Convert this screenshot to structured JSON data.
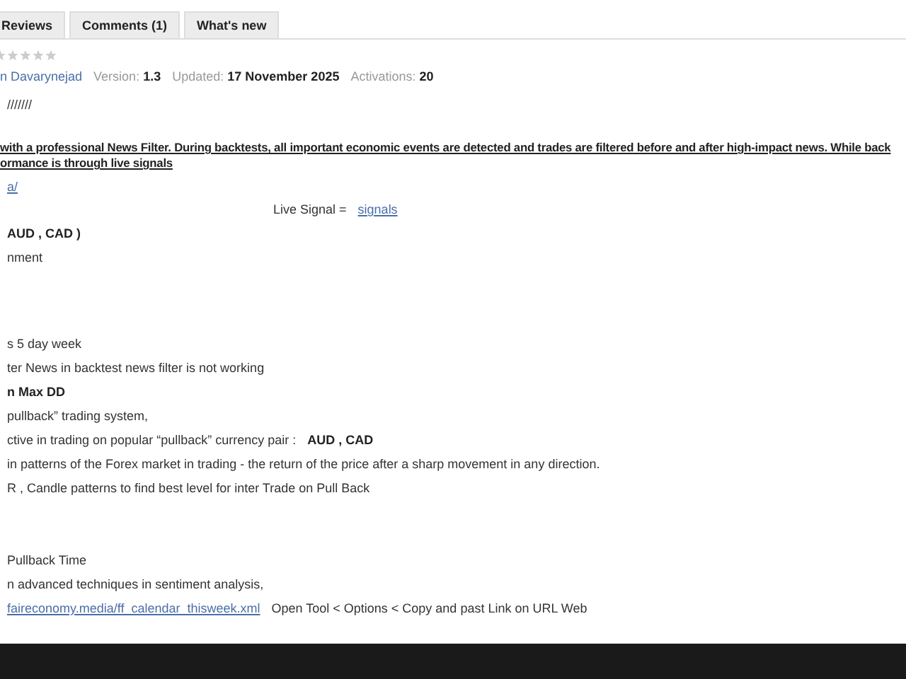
{
  "tabs": [
    {
      "label": "Reviews",
      "selected": false
    },
    {
      "label": "Comments (1)",
      "selected": false
    },
    {
      "label": "What's new",
      "selected": false
    }
  ],
  "rating": {
    "stars": 0
  },
  "meta": {
    "author": "n Davarynejad",
    "fields": [
      {
        "label": "Version:",
        "value": "1.3"
      },
      {
        "label": "Updated:",
        "value": "17 November 2025"
      },
      {
        "label": "Activations:",
        "value": "20"
      }
    ]
  },
  "lines": [
    {
      "kind": "plain",
      "parts": [
        {
          "kind": "plain",
          "text": "///////"
        }
      ]
    },
    {
      "kind": "headline",
      "parts": [
        {
          "kind": "bold-link",
          "text": "with a professional News Filter. During backtests, all important economic events are detected and trades are filtered before and after high-impact news. While back"
        }
      ]
    },
    {
      "kind": "headline",
      "parts": [
        {
          "kind": "bold-link",
          "text": "ormance is through live signals"
        }
      ]
    },
    {
      "kind": "plain",
      "parts": [
        {
          "kind": "link",
          "text": "a/"
        }
      ]
    },
    {
      "kind": "centered",
      "parts": [
        {
          "kind": "plain",
          "text": "Live Signal  ="
        },
        {
          "kind": "link",
          "text": "signals"
        }
      ]
    },
    {
      "kind": "plain",
      "parts": [
        {
          "kind": "bold",
          "text": "AUD , CAD )"
        }
      ]
    },
    {
      "kind": "plain",
      "parts": [
        {
          "kind": "plain",
          "text": "nment"
        }
      ]
    },
    {
      "kind": "plain",
      "parts": [
        {
          "kind": "plain",
          "text": "s   5 day week"
        }
      ]
    },
    {
      "kind": "plain",
      "parts": [
        {
          "kind": "plain",
          "text": "ter News  in  backtest news filter is not working"
        }
      ]
    },
    {
      "kind": "plain",
      "parts": [
        {
          "kind": "bold",
          "text": "n Max DD"
        }
      ]
    },
    {
      "kind": "plain",
      "parts": [
        {
          "kind": "plain",
          "text": "pullback” trading system,"
        }
      ]
    },
    {
      "kind": "plain",
      "parts": [
        {
          "kind": "plain",
          "text": "ctive in trading on popular “pullback” currency pair :"
        },
        {
          "kind": "bold",
          "text": "AUD , CAD"
        }
      ]
    },
    {
      "kind": "plain",
      "parts": [
        {
          "kind": "plain",
          "text": "in patterns of the Forex market in trading - the return of the price after a sharp movement in any direction."
        }
      ]
    },
    {
      "kind": "plain",
      "parts": [
        {
          "kind": "plain",
          "text": "R , Candle patterns to find best level for inter Trade on Pull Back"
        }
      ]
    },
    {
      "kind": "plain",
      "parts": [
        {
          "kind": "plain",
          "text": "Pullback Time"
        }
      ]
    },
    {
      "kind": "plain",
      "parts": [
        {
          "kind": "plain",
          "text": "n advanced techniques in sentiment analysis,"
        }
      ]
    },
    {
      "kind": "plain",
      "parts": [
        {
          "kind": "link",
          "text": "faireconomy.media/ff_calendar_thisweek.xml"
        },
        {
          "kind": "plain",
          "text": "Open Tool < Options < Copy and past Link on URL Web"
        }
      ]
    }
  ]
}
